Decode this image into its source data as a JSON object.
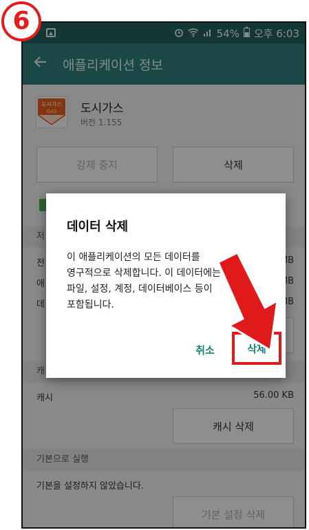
{
  "step_badge": "6",
  "status_bar": {
    "battery": "54%",
    "time": "오후 6:03"
  },
  "toolbar": {
    "title": "애플리케이션 정보"
  },
  "app": {
    "name": "도시가스",
    "version": "버전 1.155",
    "icon_text_top": "도시가스",
    "icon_text_bottom": "GAS"
  },
  "buttons": {
    "force_stop": "강제 중지",
    "uninstall": "삭제"
  },
  "storage": {
    "section_label": "저",
    "row1_label": "전",
    "row1_value": "MB",
    "row2_label": "애",
    "row2_value": "MB",
    "row3_label": "데",
    "row3_value": "MB"
  },
  "cache": {
    "section_label": "캐",
    "label": "캐시",
    "value": "56.00 KB",
    "clear_button": "캐시 삭제"
  },
  "defaults": {
    "section_label": "기본으로 실행",
    "text": "기본을 설정하지 않았습니다.",
    "clear_button": "기본 설정 삭제"
  },
  "dialog": {
    "title": "데이터 삭제",
    "line1": "이 애플리케이션의 모든 데이터를",
    "line2": "영구적으로 삭제합니다. 이 데이터에는 모든",
    "line3": "파일, 설정, 계정, 데이터베이스 등이",
    "line4": "포함됩니다.",
    "cancel": "취소",
    "confirm": "삭제"
  },
  "colors": {
    "toolbar": "#2e7d7b",
    "statusbar": "#24605e",
    "accent": "#1a7e79",
    "highlight": "#e01a1a"
  }
}
